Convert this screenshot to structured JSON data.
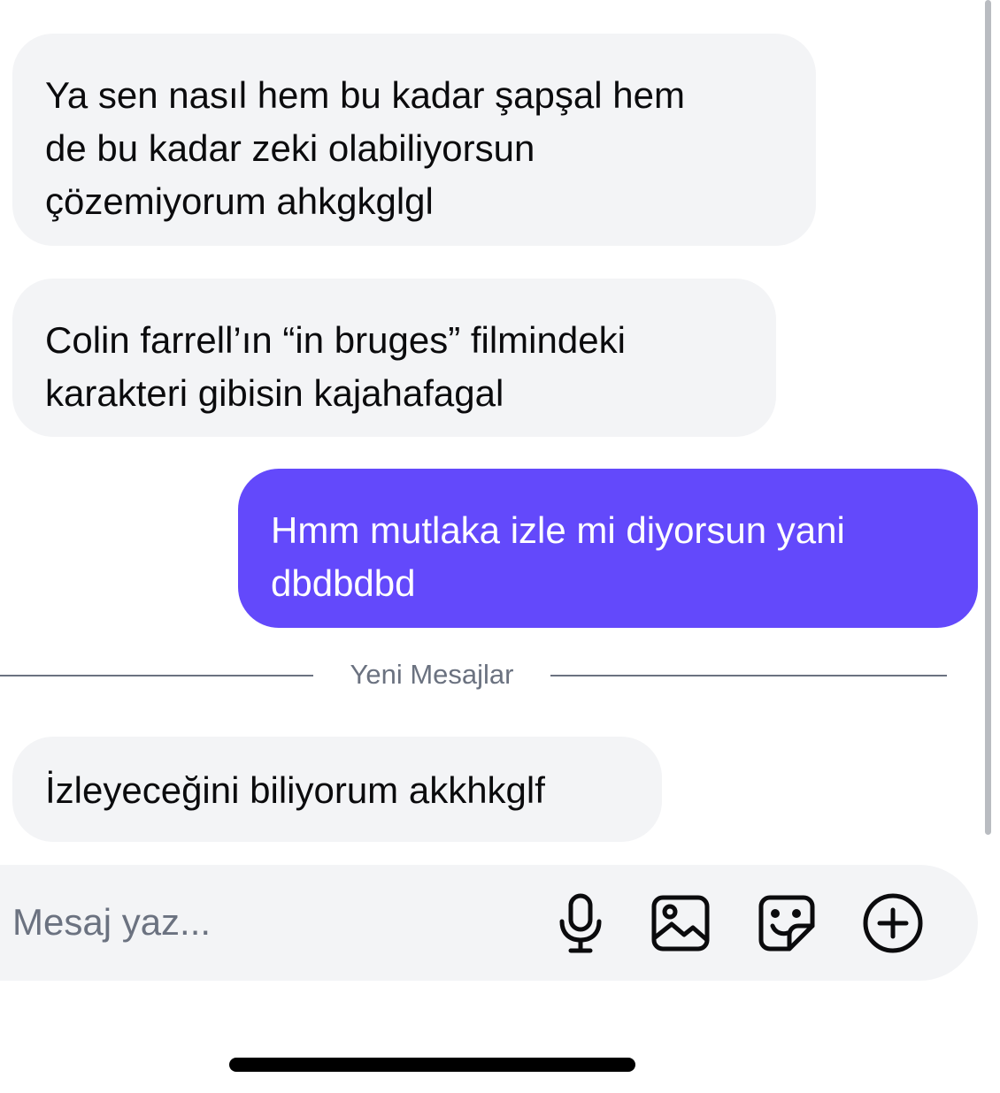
{
  "messages": [
    {
      "direction": "incoming",
      "text": "Ya sen nasıl hem bu kadar şapşal hem\nde bu kadar zeki olabiliyorsun\nçözemiyorum ahkgkglgl"
    },
    {
      "direction": "incoming",
      "text": "Colin farrell’ın “in bruges” filmindeki\nkarakteri gibisin kajahafagal"
    },
    {
      "direction": "outgoing",
      "text": "Hmm mutlaka izle mi diyorsun yani\ndbdbdbd"
    },
    {
      "direction": "incoming",
      "text": "İzleyeceğini biliyorum akkhkglf"
    }
  ],
  "divider": {
    "label": "Yeni Mesajlar"
  },
  "composer": {
    "placeholder": "Mesaj yaz...",
    "value": "",
    "icons": [
      "microphone-icon",
      "image-icon",
      "sticker-icon",
      "plus-circle-icon"
    ]
  },
  "colors": {
    "incoming_bubble": "#f3f4f6",
    "outgoing_bubble": "#6349fb",
    "outgoing_text": "#ffffff",
    "muted_text": "#6b7280"
  }
}
